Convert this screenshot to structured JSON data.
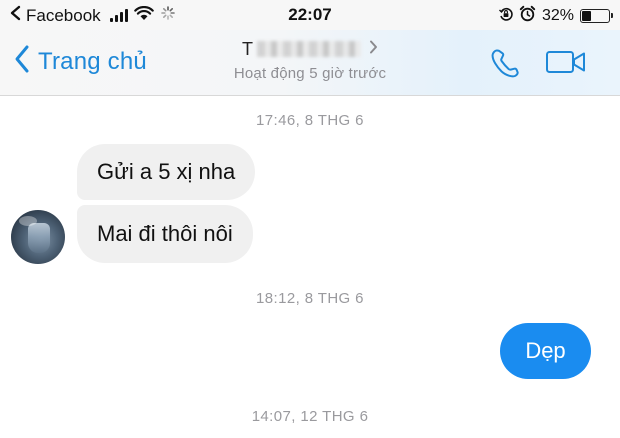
{
  "status_bar": {
    "back_app_label": "Facebook",
    "time": "22:07",
    "battery_percent_label": "32%",
    "battery_level": 0.32,
    "icons": [
      "back-arrow-icon",
      "cellular-signal-icon",
      "wifi-icon",
      "activity-spinner-icon",
      "orientation-lock-icon",
      "alarm-icon",
      "battery-icon"
    ]
  },
  "header": {
    "back_label": "Trang chủ",
    "contact_name_visible": "T",
    "contact_status": "Hoạt động 5 giờ trước",
    "icons": [
      "chevron-left-icon",
      "chevron-right-icon",
      "phone-icon",
      "video-camera-icon"
    ]
  },
  "conversation": {
    "timestamps": [
      "17:46, 8 THG 6",
      "18:12, 8 THG 6",
      "14:07, 12 THG 6"
    ],
    "incoming": [
      "Gửi a 5 xị nha",
      "Mai đi thôi nôi"
    ],
    "outgoing": [
      "Dẹp"
    ]
  },
  "colors": {
    "accent": "#1e88d8",
    "outgoing_bubble": "#1a8cf0",
    "incoming_bubble": "#f0f0f0",
    "timestamp_text": "#9a9a9e"
  }
}
